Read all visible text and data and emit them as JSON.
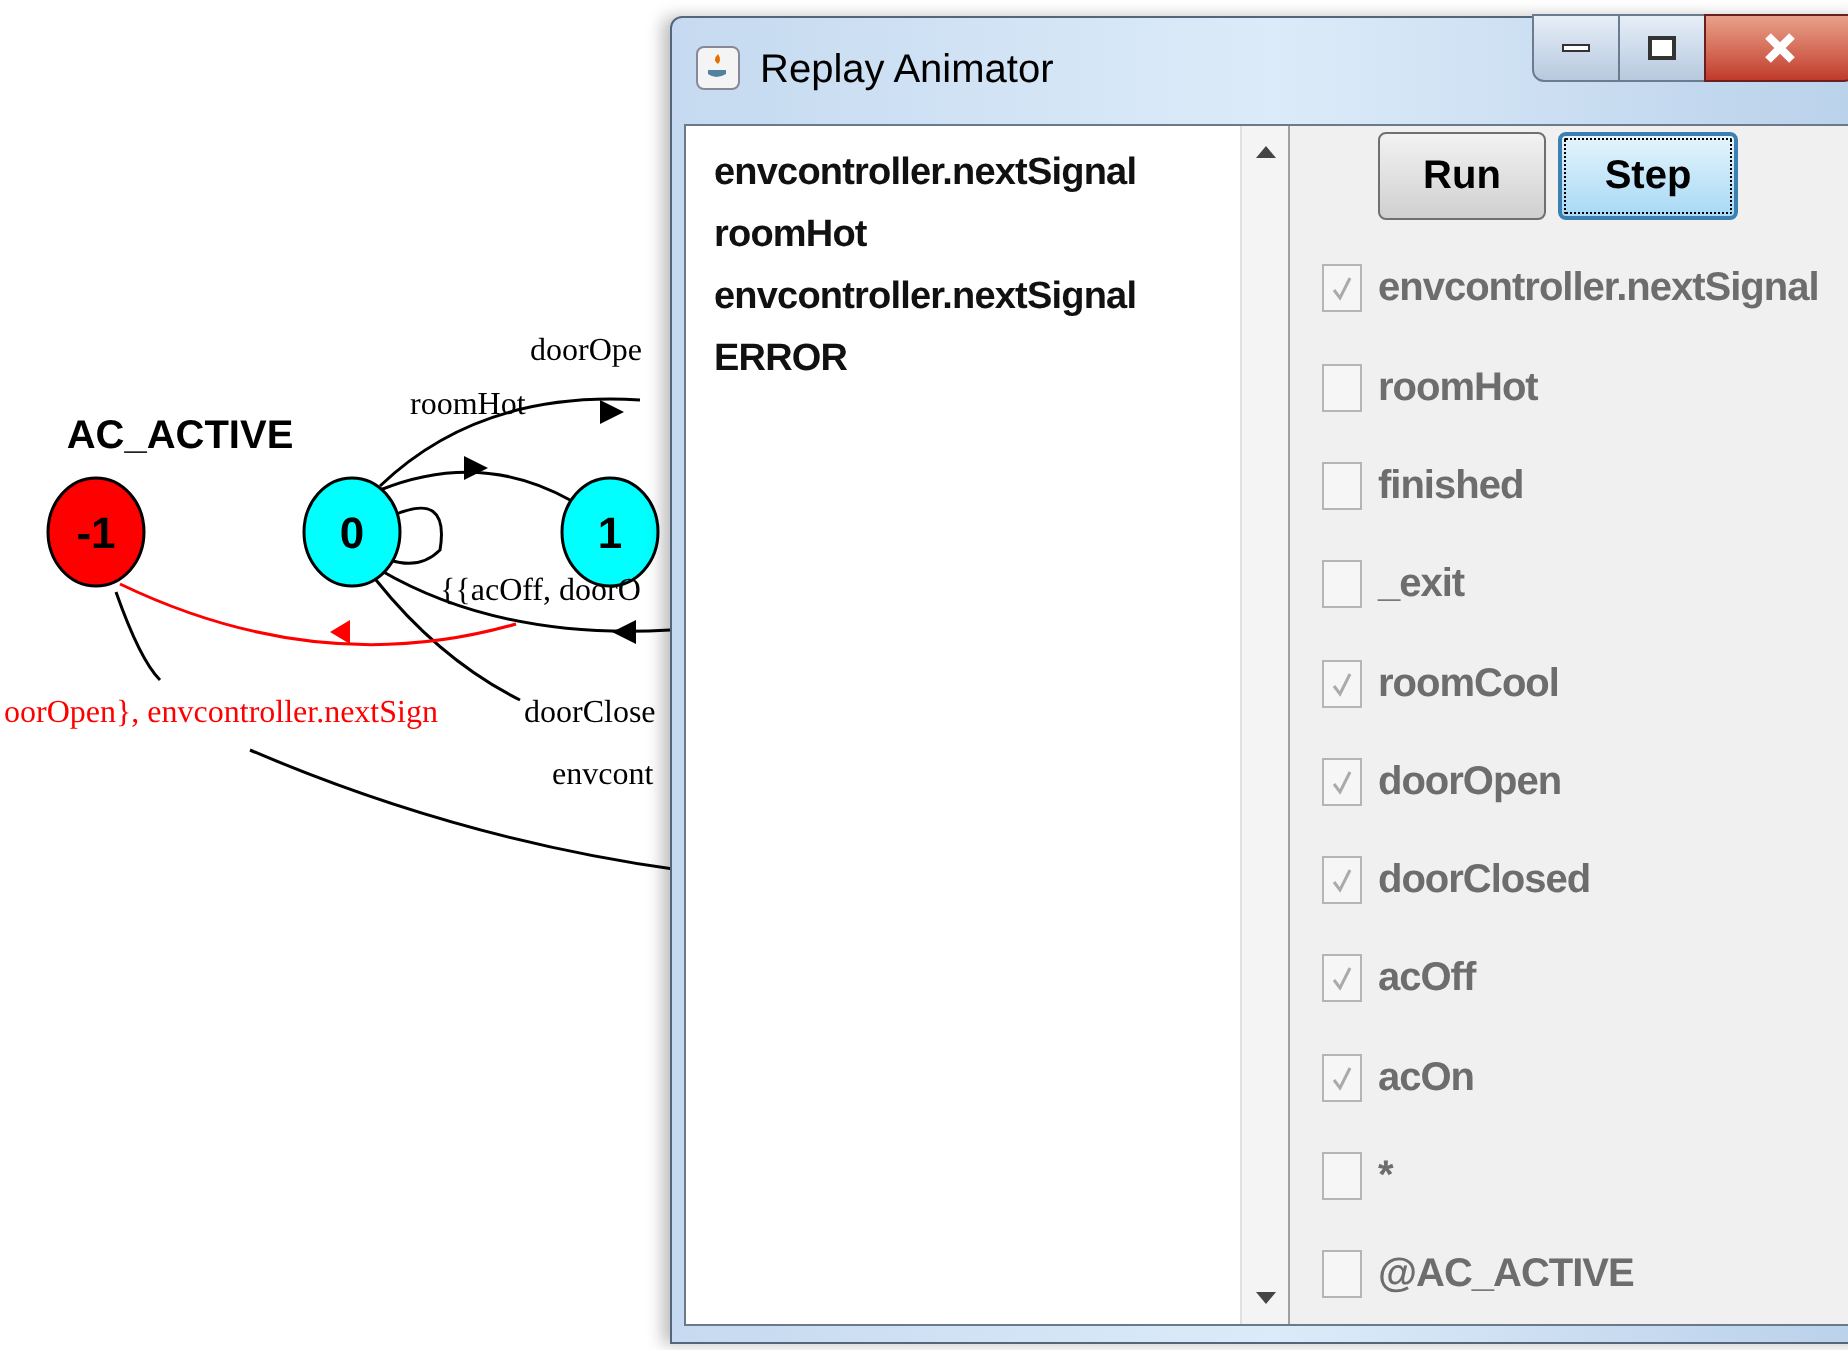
{
  "graph": {
    "state_label": "AC_ACTIVE",
    "nodes": [
      {
        "label": "-1",
        "color": "#ff0000"
      },
      {
        "label": "0",
        "color": "#00ffff"
      },
      {
        "label": "1",
        "color": "#00ffff"
      }
    ],
    "edge_labels": [
      {
        "text": "doorOpe",
        "color": "#000000"
      },
      {
        "text": "roomHot",
        "color": "#000000"
      },
      {
        "text": "{{acOff, doorO",
        "color": "#000000"
      },
      {
        "text": "oorOpen}, envcontroller.nextSign",
        "color": "#ff0000"
      },
      {
        "text": "doorClose",
        "color": "#000000"
      },
      {
        "text": "envcont",
        "color": "#000000"
      }
    ]
  },
  "window": {
    "title": "Replay Animator",
    "trace": [
      "envcontroller.nextSignal",
      "roomHot",
      "envcontroller.nextSignal",
      "ERROR"
    ],
    "buttons": [
      {
        "label": "Run",
        "focused": false
      },
      {
        "label": "Step",
        "focused": true
      }
    ],
    "actions": [
      {
        "label": "envcontroller.nextSignal",
        "checked": true,
        "disabled": true
      },
      {
        "label": "roomHot",
        "checked": false,
        "disabled": true
      },
      {
        "label": "finished",
        "checked": false,
        "disabled": true
      },
      {
        "label": "_exit",
        "checked": false,
        "disabled": true
      },
      {
        "label": "roomCool",
        "checked": true,
        "disabled": true
      },
      {
        "label": "doorOpen",
        "checked": true,
        "disabled": true
      },
      {
        "label": "doorClosed",
        "checked": true,
        "disabled": true
      },
      {
        "label": "acOff",
        "checked": true,
        "disabled": true
      },
      {
        "label": "acOn",
        "checked": true,
        "disabled": true
      },
      {
        "label": "*",
        "checked": false,
        "disabled": true
      },
      {
        "label": "@AC_ACTIVE",
        "checked": false,
        "disabled": true
      }
    ]
  }
}
